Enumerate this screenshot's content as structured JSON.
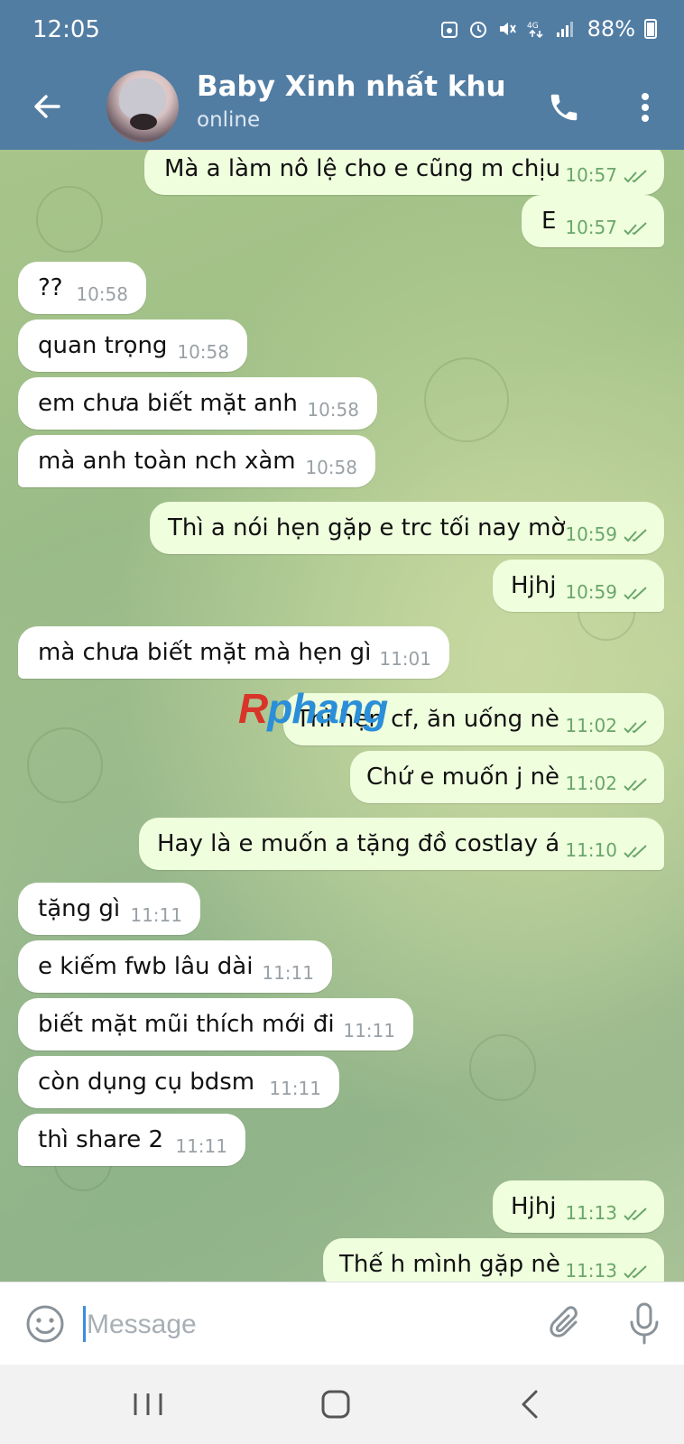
{
  "status_bar": {
    "time": "12:05",
    "battery": "88%",
    "icons": [
      "save-icon",
      "alarm-icon",
      "mute-icon",
      "4g-data-icon",
      "signal-icon",
      "battery-icon"
    ]
  },
  "header": {
    "title": "Baby Xinh nhất khu",
    "status": "online",
    "icons": [
      "back-arrow-icon",
      "phone-icon",
      "more-vertical-icon"
    ]
  },
  "messages": [
    {
      "side": "out",
      "text": "Mà a làm nô lệ cho e cũng m chịu",
      "time": "10:57",
      "read": true
    },
    {
      "side": "out",
      "text": "E",
      "time": "10:57",
      "read": true
    },
    {
      "side": "in",
      "text": "??",
      "time": "10:58"
    },
    {
      "side": "in",
      "text": "quan trọng",
      "time": "10:58"
    },
    {
      "side": "in",
      "text": "em chưa biết mặt anh",
      "time": "10:58"
    },
    {
      "side": "in",
      "text": "mà anh toàn nch xàm",
      "time": "10:58"
    },
    {
      "side": "out",
      "text": "Thì a nói hẹn gặp e trc tối nay mờ",
      "time": "10:59",
      "read": true
    },
    {
      "side": "out",
      "text": "Hjhj",
      "time": "10:59",
      "read": true
    },
    {
      "side": "in",
      "text": "mà chưa biết mặt mà hẹn gì",
      "time": "11:01"
    },
    {
      "side": "out",
      "text": "Thì hẹn cf, ăn uống nè",
      "time": "11:02",
      "read": true
    },
    {
      "side": "out",
      "text": "Chứ e muốn j nè",
      "time": "11:02",
      "read": true
    },
    {
      "side": "out",
      "text": "Hay là e muốn a tặng đồ costlay á",
      "time": "11:10",
      "read": true
    },
    {
      "side": "in",
      "text": "tặng gì",
      "time": "11:11"
    },
    {
      "side": "in",
      "text": "e kiếm fwb lâu dài",
      "time": "11:11"
    },
    {
      "side": "in",
      "text": "biết mặt mũi thích mới đi",
      "time": "11:11"
    },
    {
      "side": "in",
      "text": "còn dụng cụ bdsm",
      "time": "11:11"
    },
    {
      "side": "in",
      "text": "thì share 2",
      "time": "11:11"
    },
    {
      "side": "out",
      "text": "Hjhj",
      "time": "11:13",
      "read": true
    },
    {
      "side": "out",
      "text": "Thế h mình gặp nè",
      "time": "11:13",
      "read": true
    }
  ],
  "watermark": {
    "part_red": "R",
    "part_blue": "phang",
    "colors": {
      "red": "#d8342a",
      "blue": "#2a8ed8"
    }
  },
  "input": {
    "placeholder": "Message",
    "icons": [
      "emoji-icon",
      "paperclip-icon",
      "microphone-icon"
    ]
  },
  "navbar": {
    "icons": [
      "recents-icon",
      "home-icon",
      "nav-back-icon"
    ]
  },
  "colors": {
    "header": "#527da3",
    "bubble_in": "#ffffff",
    "bubble_out": "#effedd",
    "time_out": "#6aa66b",
    "time_in": "#9aa1a6"
  }
}
